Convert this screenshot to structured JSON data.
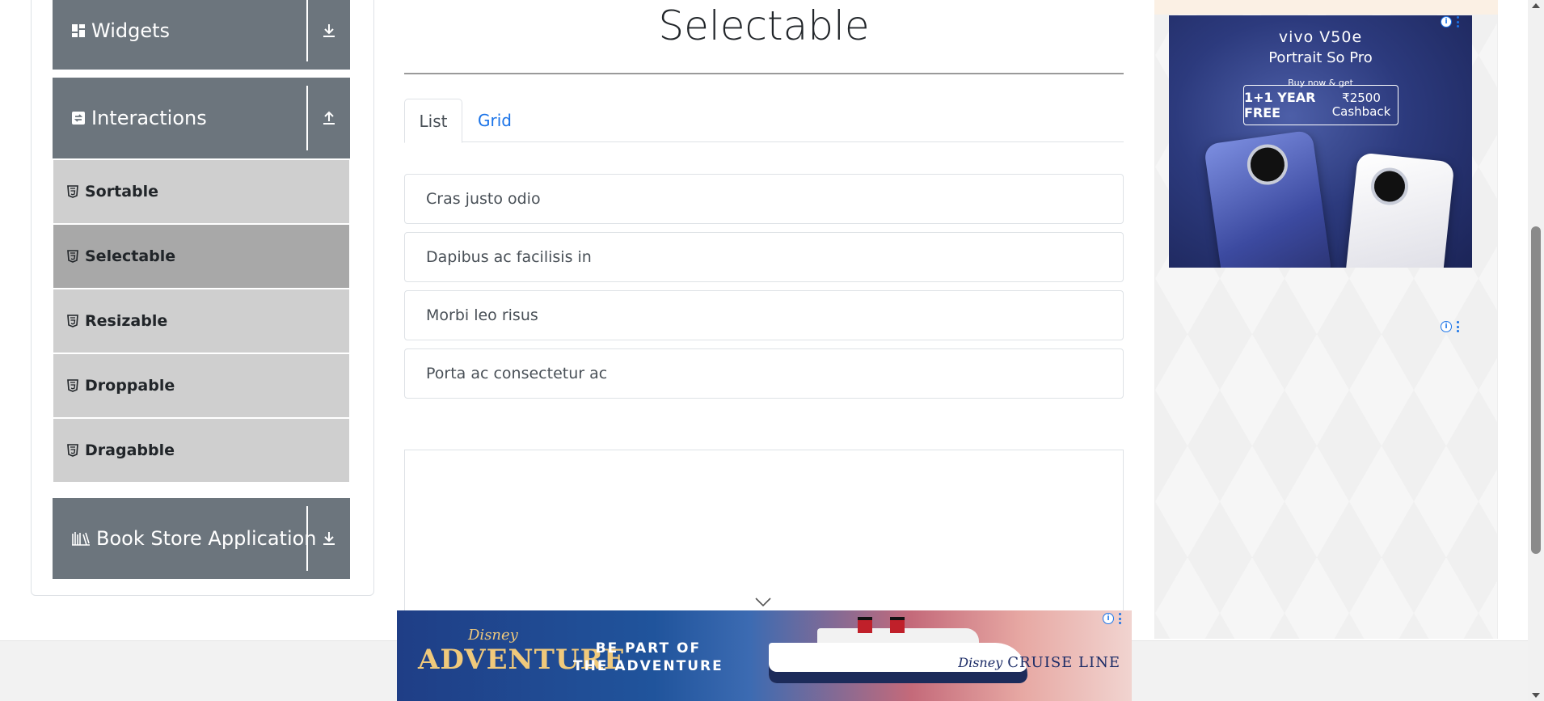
{
  "sidebar": {
    "groups": {
      "widgets": {
        "label": "Widgets",
        "icon": "widgets-grid-icon",
        "toggle_icon": "download-arrow-icon"
      },
      "interactions": {
        "label": "Interactions",
        "icon": "interactions-icon",
        "toggle_icon": "upload-arrow-icon"
      },
      "book_store": {
        "label": "Book Store Application",
        "icon": "books-icon",
        "toggle_icon": "download-arrow-icon"
      }
    },
    "items": [
      {
        "label": "Sortable",
        "icon": "html5-icon",
        "active": false
      },
      {
        "label": "Selectable",
        "icon": "html5-icon",
        "active": true
      },
      {
        "label": "Resizable",
        "icon": "html5-icon",
        "active": false
      },
      {
        "label": "Droppable",
        "icon": "html5-icon",
        "active": false
      },
      {
        "label": "Dragabble",
        "icon": "html5-icon",
        "active": false
      }
    ]
  },
  "main": {
    "title": "Selectable",
    "tabs": [
      {
        "label": "List",
        "active": true
      },
      {
        "label": "Grid",
        "active": false
      }
    ],
    "list_items": [
      "Cras justo odio",
      "Dapibus ac facilisis in",
      "Morbi leo risus",
      "Porta ac consectetur ac"
    ]
  },
  "ads": {
    "vivo": {
      "brand": "vivo V50e",
      "tagline": "Portrait So Pro",
      "buy": "Buy now & get",
      "offer_free": "1+1 YEAR FREE",
      "offer_cash": "₹2500 Cashback"
    },
    "disney": {
      "brand_top": "Disney",
      "brand_main": "ADVENTURE",
      "slogan_line1": "BE PART OF",
      "slogan_line2": "THE ADVENTURE",
      "cruise_brand": "Disney",
      "cruise_line": "CRUISE LINE"
    }
  },
  "colors": {
    "sidebar_header": "#6c757d",
    "sidebar_item": "#cfcfcf",
    "sidebar_item_active": "#a8a8a8",
    "link": "#1a73e8"
  }
}
